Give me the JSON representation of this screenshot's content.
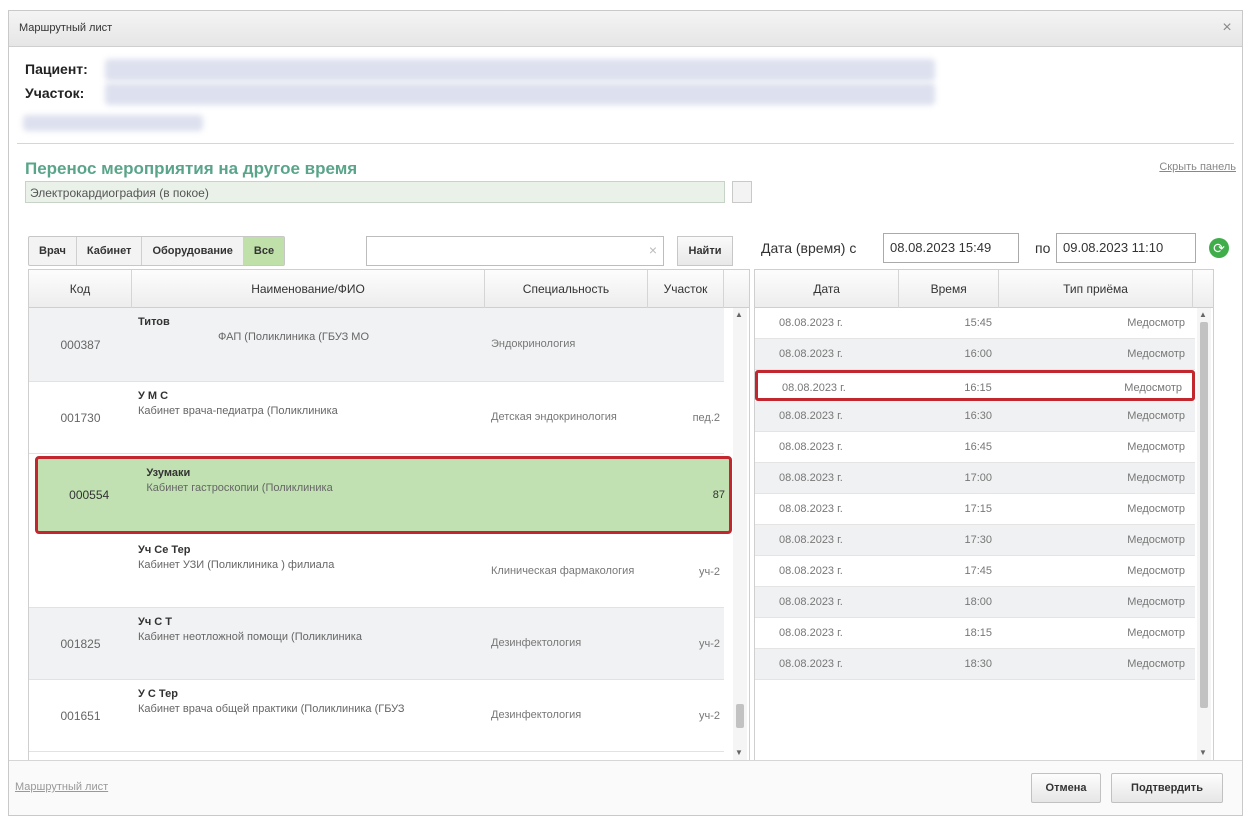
{
  "dialog": {
    "title": "Маршрутный лист",
    "close_glyph": "×"
  },
  "patient": {
    "patient_label": "Пациент:",
    "area_label": "Участок:"
  },
  "transfer": {
    "section_title": "Перенос мероприятия на другое время",
    "hide_panel": "Скрыть панель",
    "event_value": "Электрокардиография (в покое)"
  },
  "filters": {
    "tabs": [
      {
        "label": "Врач",
        "active": false
      },
      {
        "label": "Кабинет",
        "active": false
      },
      {
        "label": "Оборудование",
        "active": false
      },
      {
        "label": "Все",
        "active": true
      }
    ],
    "search_value": "",
    "clear_glyph": "×",
    "find_label": "Найти"
  },
  "date_range": {
    "label": "Дата (время) с",
    "from": "08.08.2023 15:49",
    "to_label": "по",
    "to": "09.08.2023 11:10"
  },
  "doctors_table": {
    "headers": [
      "Код",
      "Наименование/ФИО",
      "Специальность",
      "Участок"
    ],
    "rows": [
      {
        "code": "000387",
        "name": "Титов",
        "cabinet": "ФАП (Поликлиника (ГБУЗ МО",
        "spec": "Эндокринология",
        "area": ""
      },
      {
        "code": "001730",
        "name": "У М С",
        "cabinet": "Кабинет врача-педиатра (Поликлиника",
        "spec": "Детская эндокринология",
        "area": "пед.2"
      },
      {
        "code": "000554",
        "name": "Узумаки",
        "cabinet": "Кабинет гастроскопии (Поликлиника",
        "spec": "",
        "area": "87"
      },
      {
        "code": "",
        "name": "Уч Се Тер",
        "cabinet": "Кабинет УЗИ (Поликлиника ) филиала",
        "spec": "Клиническая фармакология",
        "area": "уч-2"
      },
      {
        "code": "001825",
        "name": "Уч С Т",
        "cabinet": "Кабинет неотложной помощи (Поликлиника",
        "spec": "Дезинфектология",
        "area": "уч-2"
      },
      {
        "code": "001651",
        "name": "У С Тер",
        "cabinet": "Кабинет врача общей практики (Поликлиника (ГБУЗ",
        "spec": "Дезинфектология",
        "area": "уч-2"
      }
    ]
  },
  "slots_table": {
    "headers": [
      "Дата",
      "Время",
      "Тип приёма"
    ],
    "rows": [
      {
        "date": "08.08.2023 г.",
        "time": "15:45",
        "type": "Медосмотр"
      },
      {
        "date": "08.08.2023 г.",
        "time": "16:00",
        "type": "Медосмотр"
      },
      {
        "date": "08.08.2023 г.",
        "time": "16:15",
        "type": "Медосмотр"
      },
      {
        "date": "08.08.2023 г.",
        "time": "16:30",
        "type": "Медосмотр"
      },
      {
        "date": "08.08.2023 г.",
        "time": "16:45",
        "type": "Медосмотр"
      },
      {
        "date": "08.08.2023 г.",
        "time": "17:00",
        "type": "Медосмотр"
      },
      {
        "date": "08.08.2023 г.",
        "time": "17:15",
        "type": "Медосмотр"
      },
      {
        "date": "08.08.2023 г.",
        "time": "17:30",
        "type": "Медосмотр"
      },
      {
        "date": "08.08.2023 г.",
        "time": "17:45",
        "type": "Медосмотр"
      },
      {
        "date": "08.08.2023 г.",
        "time": "18:00",
        "type": "Медосмотр"
      },
      {
        "date": "08.08.2023 г.",
        "time": "18:15",
        "type": "Медосмотр"
      },
      {
        "date": "08.08.2023 г.",
        "time": "18:30",
        "type": "Медосмотр"
      }
    ]
  },
  "footer": {
    "link": "Маршрутный лист",
    "cancel": "Отмена",
    "confirm": "Подтвердить"
  },
  "colors": {
    "accent_green": "#5aa58a",
    "selected_row": "#c1e1b2",
    "highlight_border": "#c2262e",
    "active_tab": "#bfe0a9"
  }
}
